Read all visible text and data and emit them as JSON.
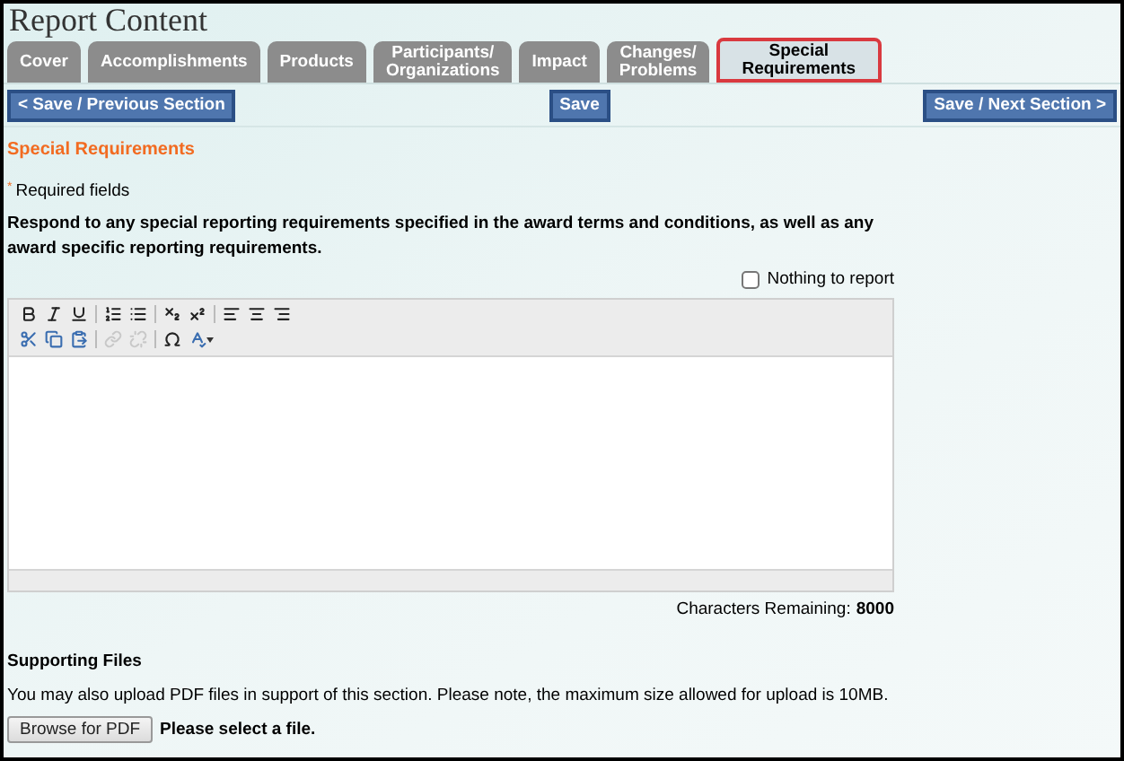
{
  "page_title": "Report Content",
  "tabs": [
    {
      "label": "Cover",
      "selected": false
    },
    {
      "label": "Accomplishments",
      "selected": false
    },
    {
      "label": "Products",
      "selected": false
    },
    {
      "label": "Participants/\nOrganizations",
      "selected": false
    },
    {
      "label": "Impact",
      "selected": false
    },
    {
      "label": "Changes/\nProblems",
      "selected": false
    },
    {
      "label": "Special\nRequirements",
      "selected": true
    }
  ],
  "nav_buttons": {
    "previous": "< Save / Previous Section",
    "save": "Save",
    "next": "Save / Next Section >"
  },
  "section_title": "Special Requirements",
  "required_mark": "*",
  "required_note": "Required fields",
  "instructions": "Respond to any special reporting requirements specified in the award terms and conditions, as well as any award specific reporting requirements.",
  "nothing_to_report": {
    "label": "Nothing to report",
    "checked": false
  },
  "toolbar": [
    [
      {
        "kind": "bold",
        "disabled": false
      },
      {
        "kind": "italic",
        "disabled": false
      },
      {
        "kind": "underline",
        "disabled": false
      },
      {
        "kind": "sep"
      },
      {
        "kind": "numbered-list",
        "disabled": false
      },
      {
        "kind": "bulleted-list",
        "disabled": false
      },
      {
        "kind": "sep"
      },
      {
        "kind": "subscript",
        "disabled": false
      },
      {
        "kind": "superscript",
        "disabled": false
      },
      {
        "kind": "sep"
      },
      {
        "kind": "align-left",
        "disabled": false
      },
      {
        "kind": "align-center",
        "disabled": false
      },
      {
        "kind": "align-right",
        "disabled": false
      }
    ],
    [
      {
        "kind": "cut",
        "disabled": false
      },
      {
        "kind": "copy",
        "disabled": false
      },
      {
        "kind": "paste",
        "disabled": false
      },
      {
        "kind": "sep"
      },
      {
        "kind": "link",
        "disabled": true
      },
      {
        "kind": "unlink",
        "disabled": true
      },
      {
        "kind": "sep"
      },
      {
        "kind": "omega",
        "disabled": false
      },
      {
        "kind": "spellcheck",
        "disabled": false
      }
    ]
  ],
  "characters_remaining": {
    "label": "Characters Remaining:",
    "value": "8000"
  },
  "supporting_files": {
    "title": "Supporting Files",
    "note": "You may also upload PDF files in support of this section. Please note, the maximum size allowed for upload is 10MB.",
    "browse_button": "Browse for PDF",
    "status": "Please select a file."
  }
}
